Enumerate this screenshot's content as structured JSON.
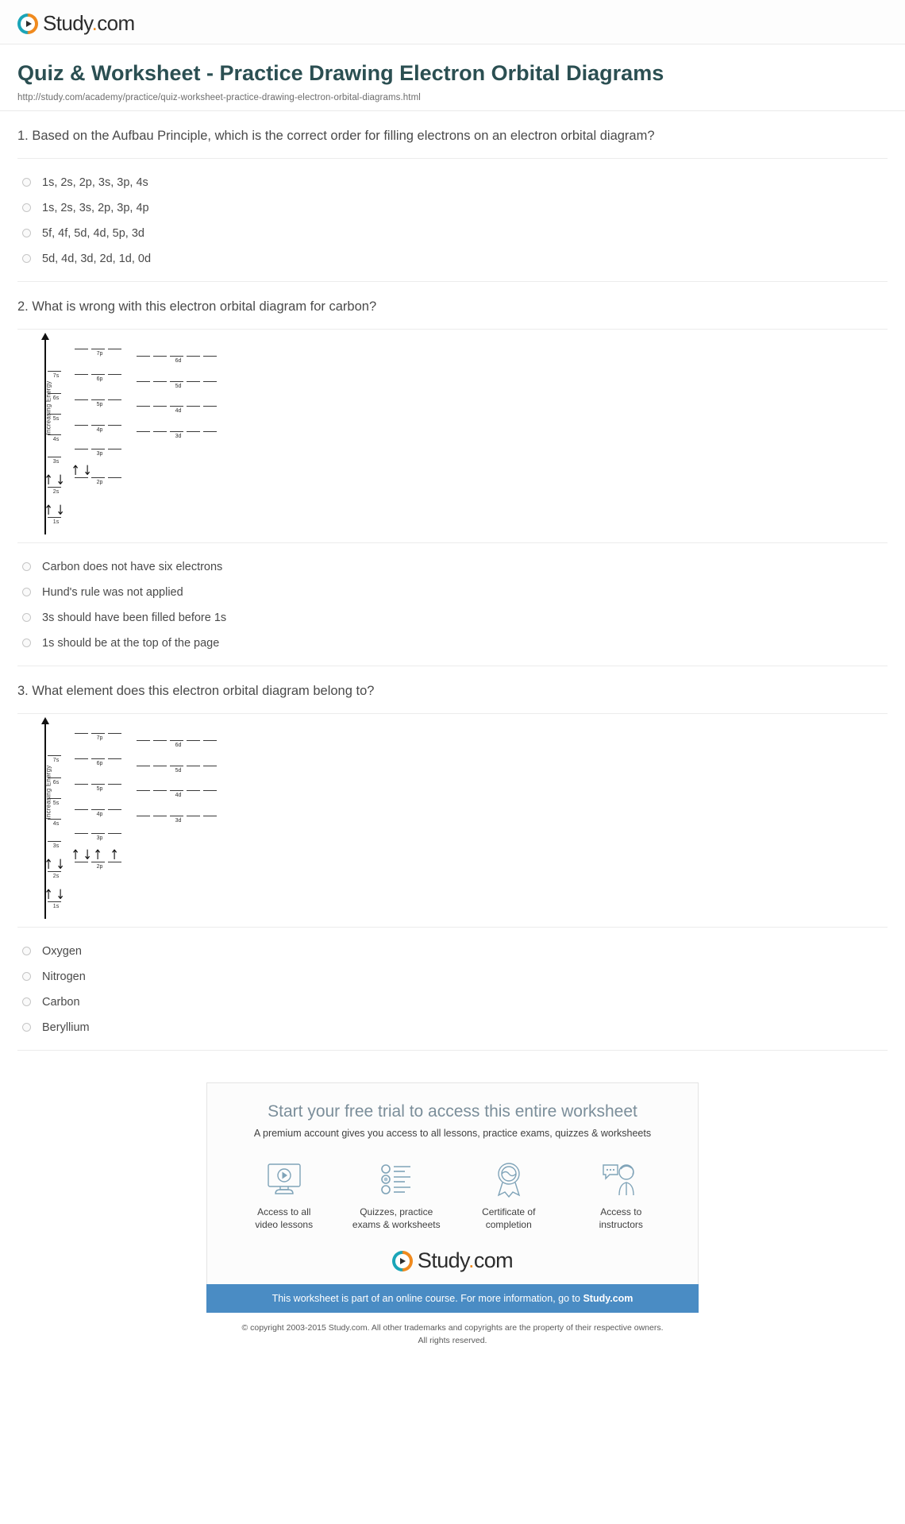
{
  "brand": {
    "name": "Study",
    "dot": ".",
    "tld": "com",
    "logo_icon": "play-circle-icon",
    "teal": "#1aa5b8",
    "orange": "#f08a1e"
  },
  "header": {
    "title": "Quiz & Worksheet - Practice Drawing Electron Orbital Diagrams",
    "url": "http://study.com/academy/practice/quiz-worksheet-practice-drawing-electron-orbital-diagrams.html",
    "title_color": "#2b4f52"
  },
  "questions": [
    {
      "number": "1.",
      "text": "1. Based on the Aufbau Principle, which is the correct order for filling electrons on an electron orbital diagram?",
      "has_diagram": false,
      "options": [
        "1s, 2s, 2p, 3s, 3p, 4s",
        "1s, 2s, 3s, 2p, 3p, 4p",
        "5f, 4f, 5d, 4d, 5p, 3d",
        "5d, 4d, 3d, 2d, 1d, 0d"
      ]
    },
    {
      "number": "2.",
      "text": "2. What is wrong with this electron orbital diagram for carbon?",
      "has_diagram": true,
      "diagram": {
        "axis_label": "Increasing Energy",
        "orbitals": [
          {
            "label": "7p",
            "boxes": 3,
            "electrons": [
              "",
              "",
              ""
            ]
          },
          {
            "label": "6d",
            "boxes": 5,
            "electrons": [
              "",
              "",
              "",
              "",
              ""
            ]
          },
          {
            "label": "7s",
            "boxes": 1,
            "electrons": [
              ""
            ]
          },
          {
            "label": "6p",
            "boxes": 3,
            "electrons": [
              "",
              "",
              ""
            ]
          },
          {
            "label": "5d",
            "boxes": 5,
            "electrons": [
              "",
              "",
              "",
              "",
              ""
            ]
          },
          {
            "label": "6s",
            "boxes": 1,
            "electrons": [
              ""
            ]
          },
          {
            "label": "5p",
            "boxes": 3,
            "electrons": [
              "",
              "",
              ""
            ]
          },
          {
            "label": "4d",
            "boxes": 5,
            "electrons": [
              "",
              "",
              "",
              "",
              ""
            ]
          },
          {
            "label": "5s",
            "boxes": 1,
            "electrons": [
              ""
            ]
          },
          {
            "label": "4p",
            "boxes": 3,
            "electrons": [
              "",
              "",
              ""
            ]
          },
          {
            "label": "3d",
            "boxes": 5,
            "electrons": [
              "",
              "",
              "",
              "",
              ""
            ]
          },
          {
            "label": "4s",
            "boxes": 1,
            "electrons": [
              ""
            ]
          },
          {
            "label": "3p",
            "boxes": 3,
            "electrons": [
              "",
              "",
              ""
            ]
          },
          {
            "label": "3s",
            "boxes": 1,
            "electrons": [
              ""
            ]
          },
          {
            "label": "2p",
            "boxes": 3,
            "electrons": [
              "updown",
              "",
              ""
            ]
          },
          {
            "label": "2s",
            "boxes": 1,
            "electrons": [
              "updown"
            ]
          },
          {
            "label": "1s",
            "boxes": 1,
            "electrons": [
              "updown"
            ]
          }
        ]
      },
      "options": [
        "Carbon does not have six electrons",
        "Hund's rule was not applied",
        "3s should have been filled before 1s",
        "1s should be at the top of the page"
      ]
    },
    {
      "number": "3.",
      "text": "3. What element does this electron orbital diagram belong to?",
      "has_diagram": true,
      "diagram": {
        "axis_label": "Increasing Energy",
        "orbitals": [
          {
            "label": "7p",
            "boxes": 3,
            "electrons": [
              "",
              "",
              ""
            ]
          },
          {
            "label": "6d",
            "boxes": 5,
            "electrons": [
              "",
              "",
              "",
              "",
              ""
            ]
          },
          {
            "label": "7s",
            "boxes": 1,
            "electrons": [
              ""
            ]
          },
          {
            "label": "6p",
            "boxes": 3,
            "electrons": [
              "",
              "",
              ""
            ]
          },
          {
            "label": "5d",
            "boxes": 5,
            "electrons": [
              "",
              "",
              "",
              "",
              ""
            ]
          },
          {
            "label": "6s",
            "boxes": 1,
            "electrons": [
              ""
            ]
          },
          {
            "label": "5p",
            "boxes": 3,
            "electrons": [
              "",
              "",
              ""
            ]
          },
          {
            "label": "4d",
            "boxes": 5,
            "electrons": [
              "",
              "",
              "",
              "",
              ""
            ]
          },
          {
            "label": "5s",
            "boxes": 1,
            "electrons": [
              ""
            ]
          },
          {
            "label": "4p",
            "boxes": 3,
            "electrons": [
              "",
              "",
              ""
            ]
          },
          {
            "label": "3d",
            "boxes": 5,
            "electrons": [
              "",
              "",
              "",
              "",
              ""
            ]
          },
          {
            "label": "4s",
            "boxes": 1,
            "electrons": [
              ""
            ]
          },
          {
            "label": "3p",
            "boxes": 3,
            "electrons": [
              "",
              "",
              ""
            ]
          },
          {
            "label": "3s",
            "boxes": 1,
            "electrons": [
              ""
            ]
          },
          {
            "label": "2p",
            "boxes": 3,
            "electrons": [
              "updown",
              "up",
              "up"
            ]
          },
          {
            "label": "2s",
            "boxes": 1,
            "electrons": [
              "updown"
            ]
          },
          {
            "label": "1s",
            "boxes": 1,
            "electrons": [
              "updown"
            ]
          }
        ]
      },
      "options": [
        "Oxygen",
        "Nitrogen",
        "Carbon",
        "Beryllium"
      ]
    }
  ],
  "promo": {
    "title": "Start your free trial to access this entire worksheet",
    "subtitle": "A premium account gives you access to all lessons, practice exams, quizzes & worksheets",
    "features": [
      {
        "icon": "monitor-play-icon",
        "line1": "Access to all",
        "line2": "video lessons"
      },
      {
        "icon": "checklist-icon",
        "line1": "Quizzes, practice",
        "line2": "exams & worksheets"
      },
      {
        "icon": "award-ribbon-icon",
        "line1": "Certificate of",
        "line2": "completion"
      },
      {
        "icon": "instructor-chat-icon",
        "line1": "Access to",
        "line2": "instructors"
      }
    ],
    "banner_prefix": "This worksheet is part of an online course. For more information, go to ",
    "banner_link": "Study.com",
    "banner_color": "#4a8cc4",
    "copyright_line1": "© copyright 2003-2015 Study.com. All other trademarks and copyrights are the property of their respective owners.",
    "copyright_line2": "All rights reserved."
  }
}
